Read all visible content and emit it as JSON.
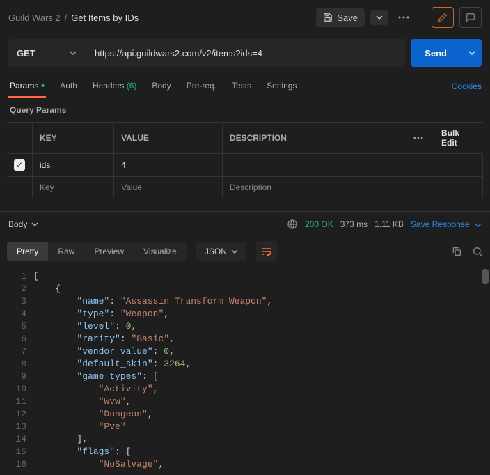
{
  "breadcrumb": {
    "parent": "Guild Wars 2",
    "sep": "/",
    "current": "Get Items by IDs"
  },
  "toolbar": {
    "save": "Save"
  },
  "request": {
    "method": "GET",
    "url": "https://api.guildwars2.com/v2/items?ids=4",
    "send": "Send"
  },
  "tabs": {
    "params": "Params",
    "auth": "Auth",
    "headers": "Headers",
    "headers_count": "(6)",
    "body": "Body",
    "prereq": "Pre-req.",
    "tests": "Tests",
    "settings": "Settings",
    "cookies": "Cookies"
  },
  "query_params": {
    "title": "Query Params",
    "cols": {
      "key": "KEY",
      "value": "VALUE",
      "desc": "DESCRIPTION",
      "bulk": "Bulk Edit"
    },
    "rows": [
      {
        "enabled": true,
        "key": "ids",
        "value": "4",
        "desc": ""
      }
    ],
    "placeholder": {
      "key": "Key",
      "value": "Value",
      "desc": "Description"
    }
  },
  "response": {
    "body_label": "Body",
    "status": "200 OK",
    "time": "373 ms",
    "size": "1.11 KB",
    "save": "Save Response"
  },
  "view": {
    "pretty": "Pretty",
    "raw": "Raw",
    "preview": "Preview",
    "visualize": "Visualize",
    "format": "JSON"
  },
  "json_body": [
    {
      "kind": "punc",
      "indent": 0,
      "text": "["
    },
    {
      "kind": "punc",
      "indent": 1,
      "text": "{"
    },
    {
      "kind": "kv",
      "indent": 2,
      "key": "name",
      "vtype": "string",
      "value": "Assassin Transform Weapon",
      "comma": true
    },
    {
      "kind": "kv",
      "indent": 2,
      "key": "type",
      "vtype": "string",
      "value": "Weapon",
      "comma": true
    },
    {
      "kind": "kv",
      "indent": 2,
      "key": "level",
      "vtype": "number",
      "value": "0",
      "comma": true
    },
    {
      "kind": "kv",
      "indent": 2,
      "key": "rarity",
      "vtype": "string",
      "value": "Basic",
      "comma": true
    },
    {
      "kind": "kv",
      "indent": 2,
      "key": "vendor_value",
      "vtype": "number",
      "value": "0",
      "comma": true
    },
    {
      "kind": "kv",
      "indent": 2,
      "key": "default_skin",
      "vtype": "number",
      "value": "3264",
      "comma": true
    },
    {
      "kind": "kopen",
      "indent": 2,
      "key": "game_types",
      "open": "["
    },
    {
      "kind": "val",
      "indent": 3,
      "vtype": "string",
      "value": "Activity",
      "comma": true
    },
    {
      "kind": "val",
      "indent": 3,
      "vtype": "string",
      "value": "Wvw",
      "comma": true
    },
    {
      "kind": "val",
      "indent": 3,
      "vtype": "string",
      "value": "Dungeon",
      "comma": true
    },
    {
      "kind": "val",
      "indent": 3,
      "vtype": "string",
      "value": "Pve",
      "comma": false
    },
    {
      "kind": "close",
      "indent": 2,
      "close": "]",
      "comma": true
    },
    {
      "kind": "kopen",
      "indent": 2,
      "key": "flags",
      "open": "["
    },
    {
      "kind": "val",
      "indent": 3,
      "vtype": "string",
      "value": "NoSalvage",
      "comma": true
    }
  ]
}
